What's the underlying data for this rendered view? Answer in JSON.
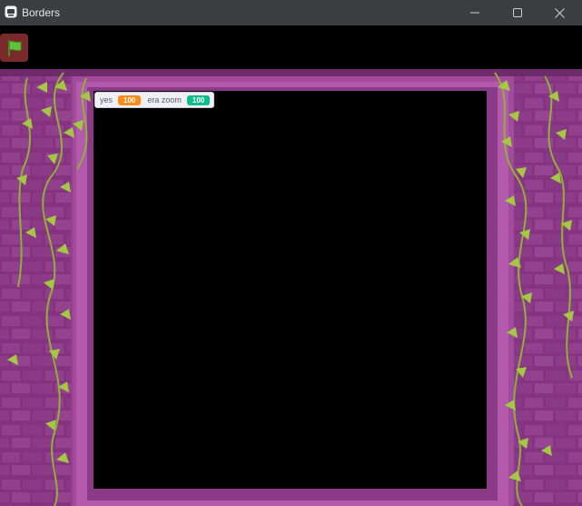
{
  "window": {
    "title": "Borders",
    "minimize_icon": "minimize-icon",
    "maximize_icon": "maximize-icon",
    "close_icon": "close-icon"
  },
  "toolbar": {
    "green_flag_icon": "green-flag-icon"
  },
  "monitors": [
    {
      "label": "yes",
      "value": "100",
      "color": "#ff8c1a"
    },
    {
      "label": "era zoom",
      "value": "100",
      "color": "#0fbd8c"
    }
  ],
  "colors": {
    "titlebar": "#3b3d40",
    "wall": "#8e3a8a",
    "frame": "#a24a9c",
    "vine": "#9bbf3a"
  }
}
